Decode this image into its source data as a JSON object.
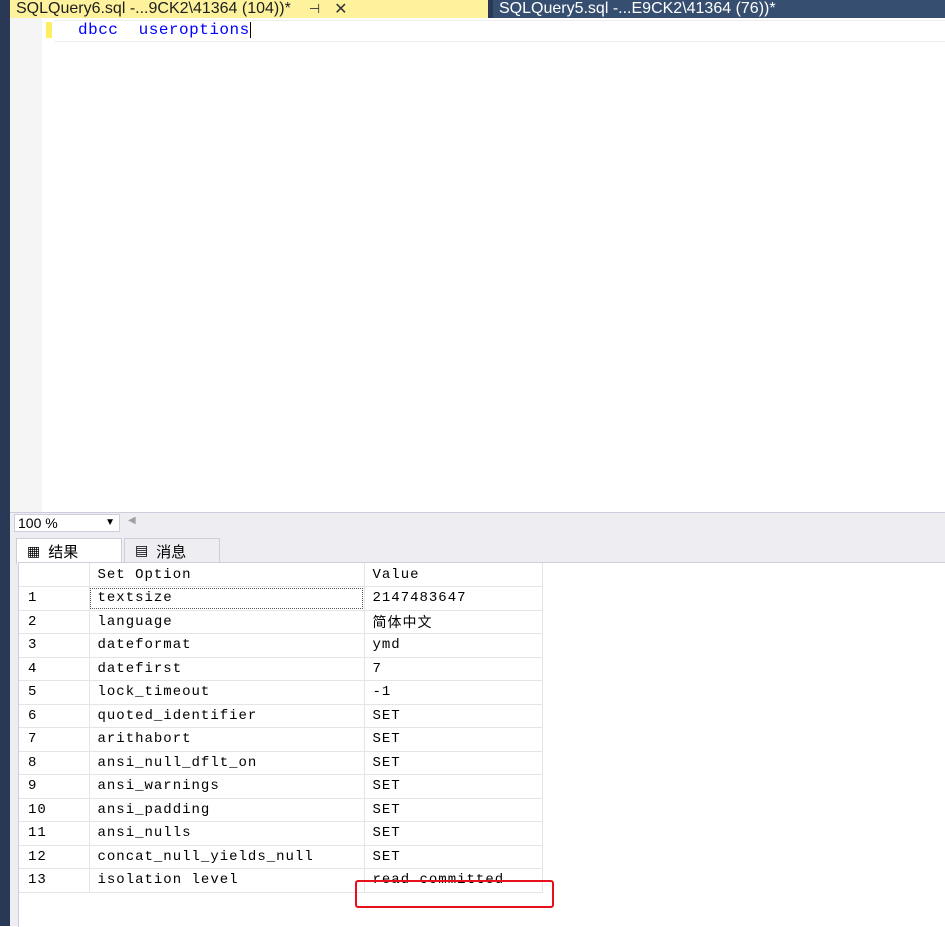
{
  "tabs": [
    {
      "title": "SQLQuery6.sql -...9CK2\\41364 (104))*",
      "active": true,
      "pin_glyph": "⊣",
      "close_glyph": "✕"
    },
    {
      "title": "SQLQuery5.sql -...E9CK2\\41364 (76))*",
      "active": false
    }
  ],
  "editor": {
    "code": "dbcc  useroptions"
  },
  "zoom": {
    "value": "100 %"
  },
  "results_tabs": [
    {
      "label": "结果",
      "icon": "grid-icon",
      "active": true
    },
    {
      "label": "消息",
      "icon": "messages-icon",
      "active": false
    }
  ],
  "grid": {
    "columns": [
      "",
      "Set Option",
      "Value"
    ],
    "rows": [
      {
        "num": "1",
        "option": "textsize",
        "value": "2147483647"
      },
      {
        "num": "2",
        "option": "language",
        "value": "简体中文"
      },
      {
        "num": "3",
        "option": "dateformat",
        "value": "ymd"
      },
      {
        "num": "4",
        "option": "datefirst",
        "value": "7"
      },
      {
        "num": "5",
        "option": "lock_timeout",
        "value": "-1"
      },
      {
        "num": "6",
        "option": "quoted_identifier",
        "value": "SET"
      },
      {
        "num": "7",
        "option": "arithabort",
        "value": "SET"
      },
      {
        "num": "8",
        "option": "ansi_null_dflt_on",
        "value": "SET"
      },
      {
        "num": "9",
        "option": "ansi_warnings",
        "value": "SET"
      },
      {
        "num": "10",
        "option": "ansi_padding",
        "value": "SET"
      },
      {
        "num": "11",
        "option": "ansi_nulls",
        "value": "SET"
      },
      {
        "num": "12",
        "option": "concat_null_yields_null",
        "value": "SET"
      },
      {
        "num": "13",
        "option": "isolation level",
        "value": "read committed"
      }
    ]
  },
  "colors": {
    "active_tab": "#fff29d",
    "tab_bar": "#293955",
    "code_keyword": "#0000ff",
    "highlight": "#e8101a"
  }
}
